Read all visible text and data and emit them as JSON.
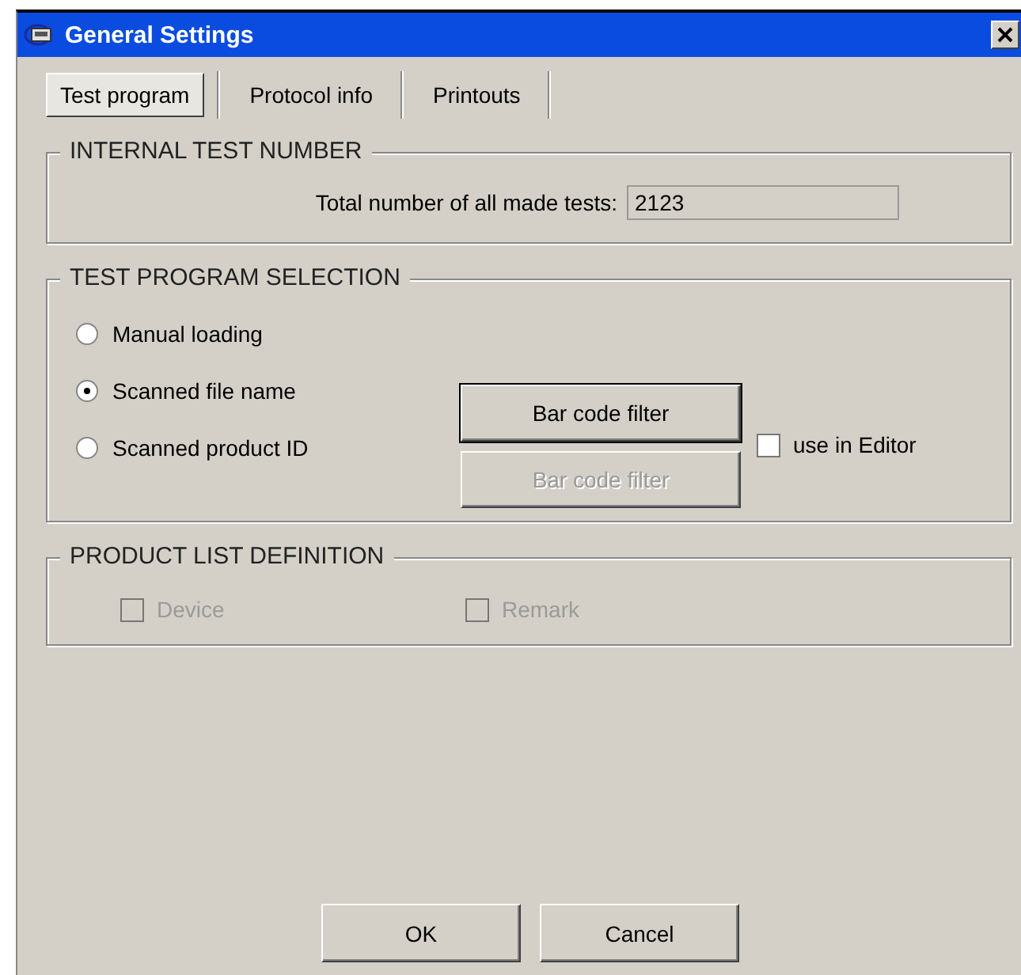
{
  "window": {
    "title": "General Settings"
  },
  "tabs": [
    {
      "label": "Test program",
      "selected": true
    },
    {
      "label": "Protocol info",
      "selected": false
    },
    {
      "label": "Printouts",
      "selected": false
    }
  ],
  "internal_test_number": {
    "legend": "INTERNAL TEST NUMBER",
    "label": "Total number of all made tests:",
    "value": "2123"
  },
  "test_program_selection": {
    "legend": "TEST PROGRAM SELECTION",
    "options": [
      {
        "label": "Manual loading",
        "selected": false
      },
      {
        "label": "Scanned file name",
        "selected": true
      },
      {
        "label": "Scanned product ID",
        "selected": false
      }
    ],
    "filter_buttons": [
      {
        "label": "Bar code filter",
        "disabled": false,
        "focused": true
      },
      {
        "label": "Bar code filter",
        "disabled": true,
        "focused": false
      }
    ],
    "use_in_editor": {
      "label": "use in Editor",
      "checked": false
    }
  },
  "product_list_definition": {
    "legend": "PRODUCT LIST DEFINITION",
    "fields": [
      {
        "label": "Device",
        "checked": false,
        "disabled": true
      },
      {
        "label": "Remark",
        "checked": false,
        "disabled": true
      }
    ]
  },
  "buttons": [
    "OK",
    "Cancel"
  ]
}
